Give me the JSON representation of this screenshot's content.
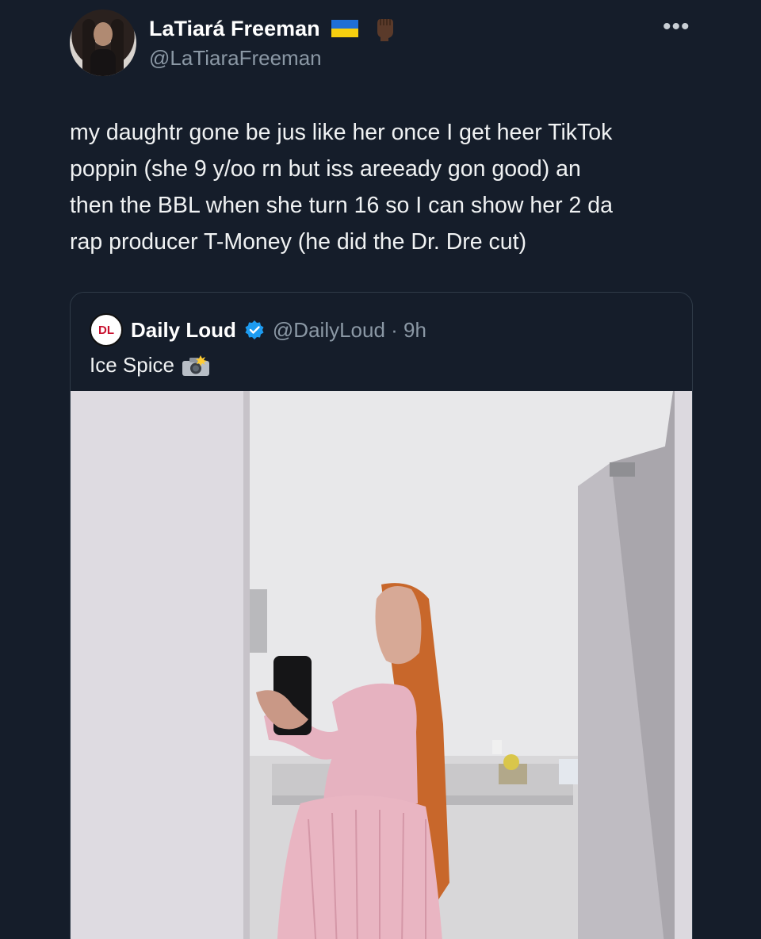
{
  "author": {
    "display_name": "LaTiará Freeman",
    "handle": "@LaTiaraFreeman",
    "flag_icon": "ukraine-flag-icon",
    "emoji_icon": "raised-fist-dark-skin-icon",
    "avatar_icon": "profile-photo-avatar"
  },
  "tweet": {
    "text": "my daughtr gone be jus like her once I get heer TikTok\npoppin (she 9 y/oo rn but iss areeady gon good) an\nthen the BBL when she turn 16 so I can show her 2 da\nrap producer T-Money (he did the Dr. Dre cut)",
    "more_icon": "more-options-icon"
  },
  "quote": {
    "name": "Daily Loud",
    "handle_time": "@DailyLoud · 9h",
    "logo_text": "DL",
    "verified_icon": "verified-badge-icon",
    "text": "Ice Spice",
    "camera_icon": "camera-flash-icon",
    "image": "mirror-selfie-photo"
  },
  "colors": {
    "background": "#151d2a",
    "text": "#f0f2f3",
    "secondary_text": "#8b98a5",
    "border": "#2f3b48",
    "verified": "#1d9bf0"
  }
}
